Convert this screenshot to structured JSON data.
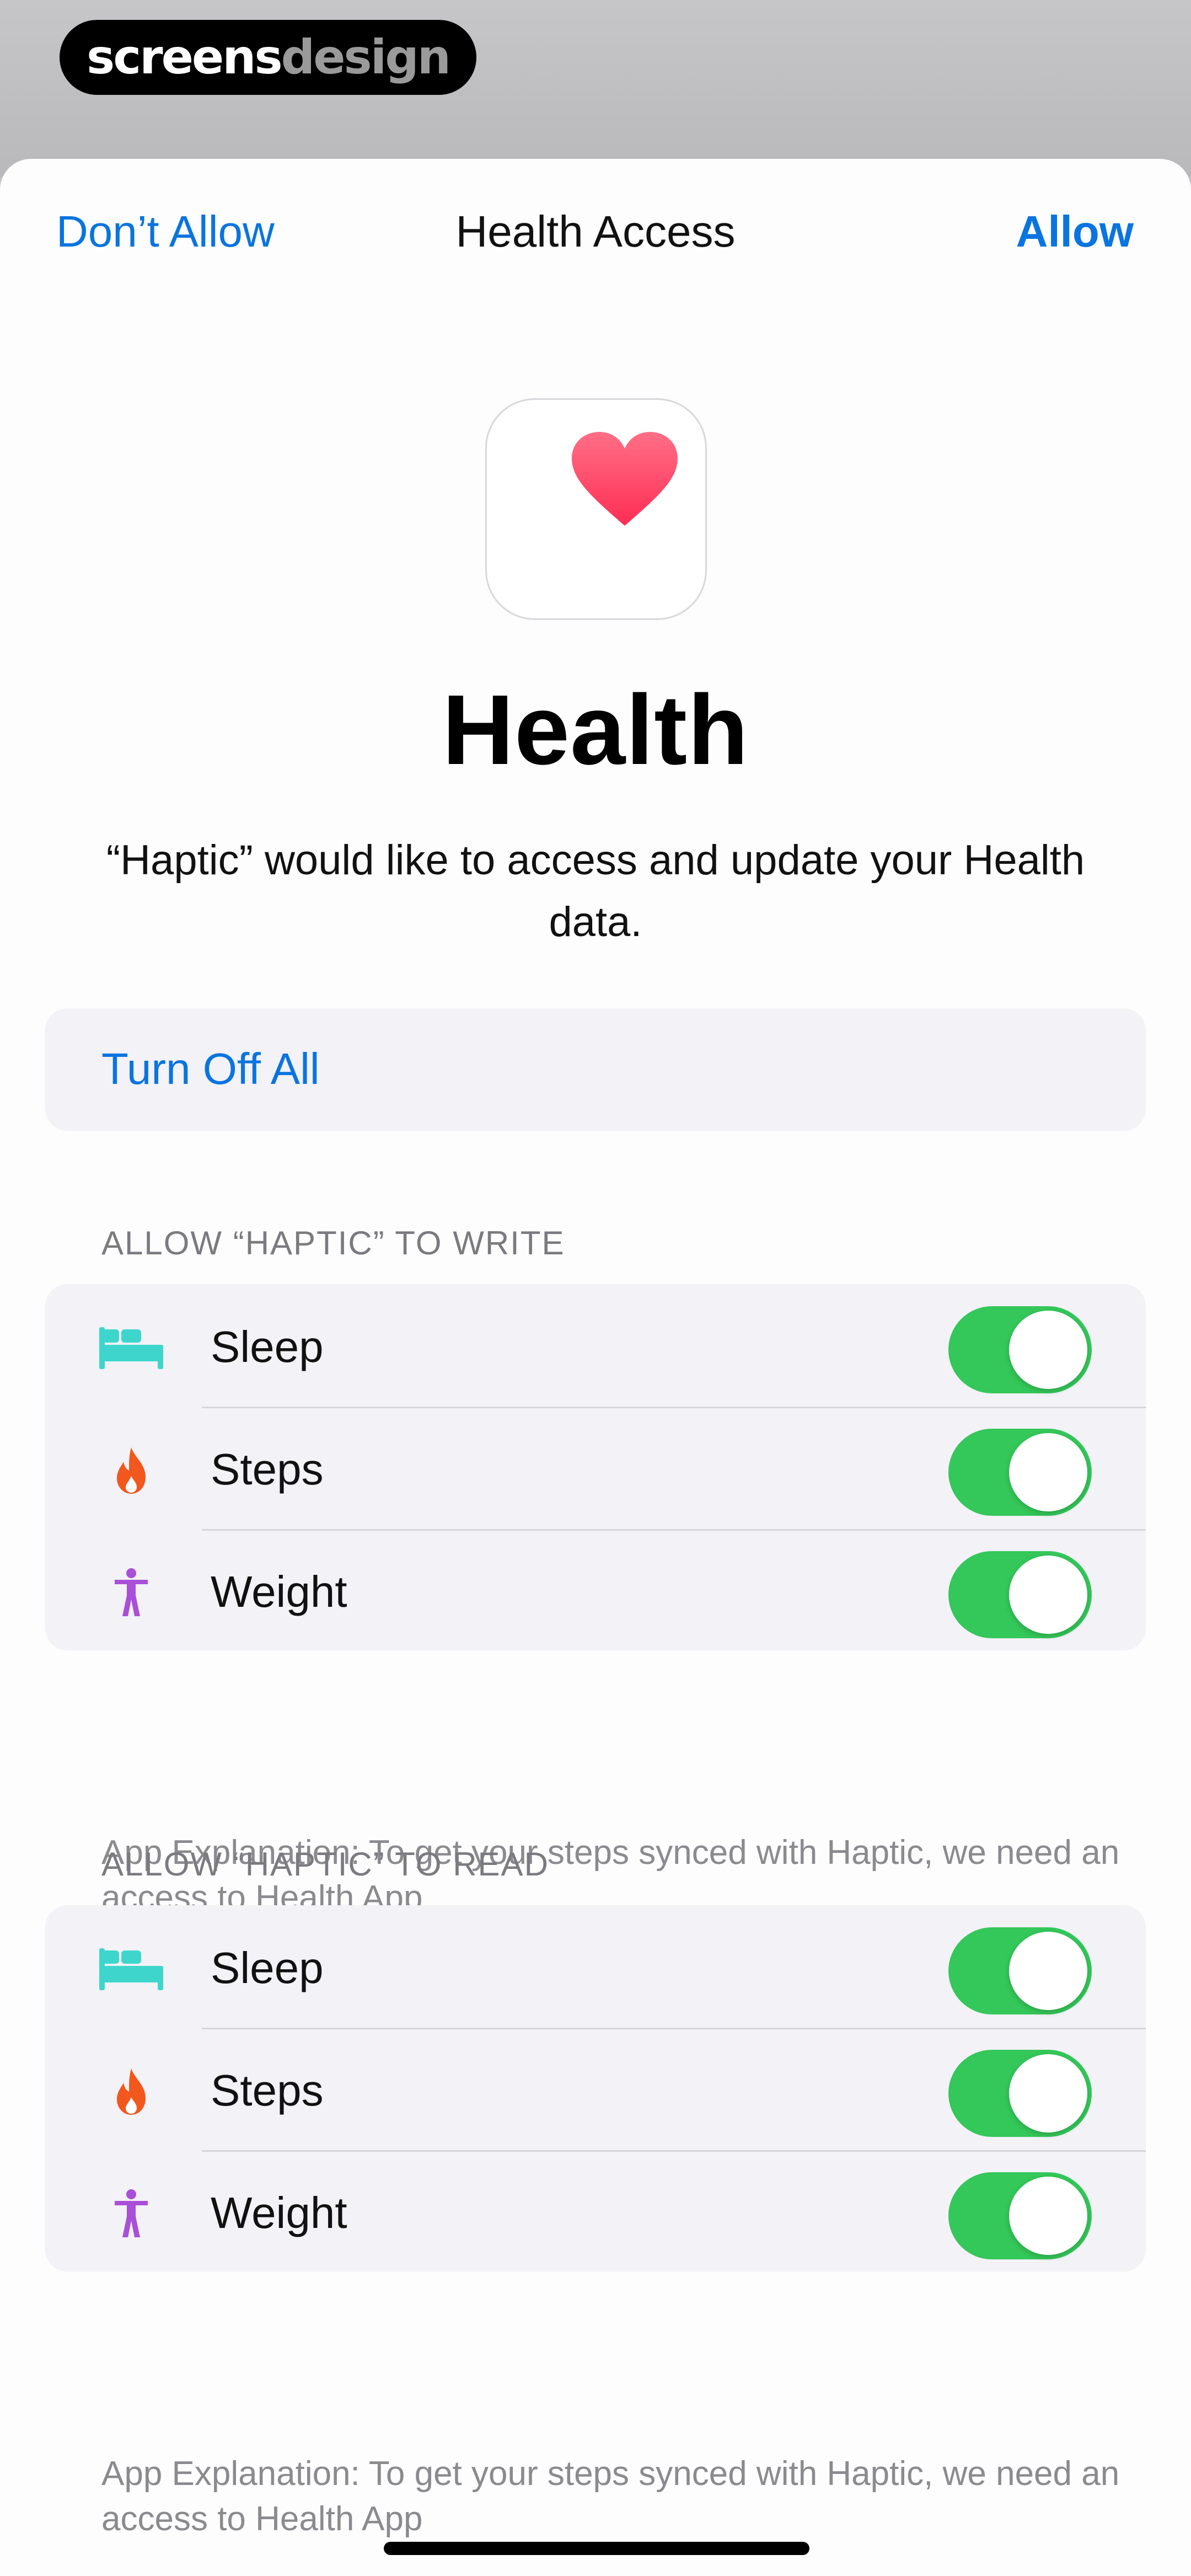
{
  "watermark": {
    "part1": "screens",
    "part2": "design"
  },
  "navbar": {
    "dont_allow_label": "Don’t Allow",
    "title": "Health Access",
    "allow_label": "Allow"
  },
  "app": {
    "icon": "heart-icon",
    "name": "Health",
    "description": "“Haptic” would like to access and update your Health data."
  },
  "turn_off_all_label": "Turn Off All",
  "write_section": {
    "header": "ALLOW “HAPTIC” TO WRITE",
    "items": [
      {
        "label": "Sleep",
        "icon": "bed-icon",
        "enabled": true
      },
      {
        "label": "Steps",
        "icon": "flame-icon",
        "enabled": true
      },
      {
        "label": "Weight",
        "icon": "figure-icon",
        "enabled": true
      }
    ],
    "explanation": "App Explanation: To get your steps synced with Haptic, we need an access to Health App"
  },
  "read_section": {
    "header": "ALLOW “HAPTIC” TO READ",
    "items": [
      {
        "label": "Sleep",
        "icon": "bed-icon",
        "enabled": true
      },
      {
        "label": "Steps",
        "icon": "flame-icon",
        "enabled": true
      },
      {
        "label": "Weight",
        "icon": "figure-icon",
        "enabled": true
      }
    ],
    "explanation": "App Explanation: To get your steps synced with Haptic, we need an access to Health App"
  },
  "colors": {
    "accent_blue": "#0a74e0",
    "toggle_on": "#34c759",
    "heart": "#ff3b5c",
    "sleep_icon": "#3ed6cc",
    "steps_icon": "#f2571d",
    "weight_icon": "#a94fd8"
  }
}
